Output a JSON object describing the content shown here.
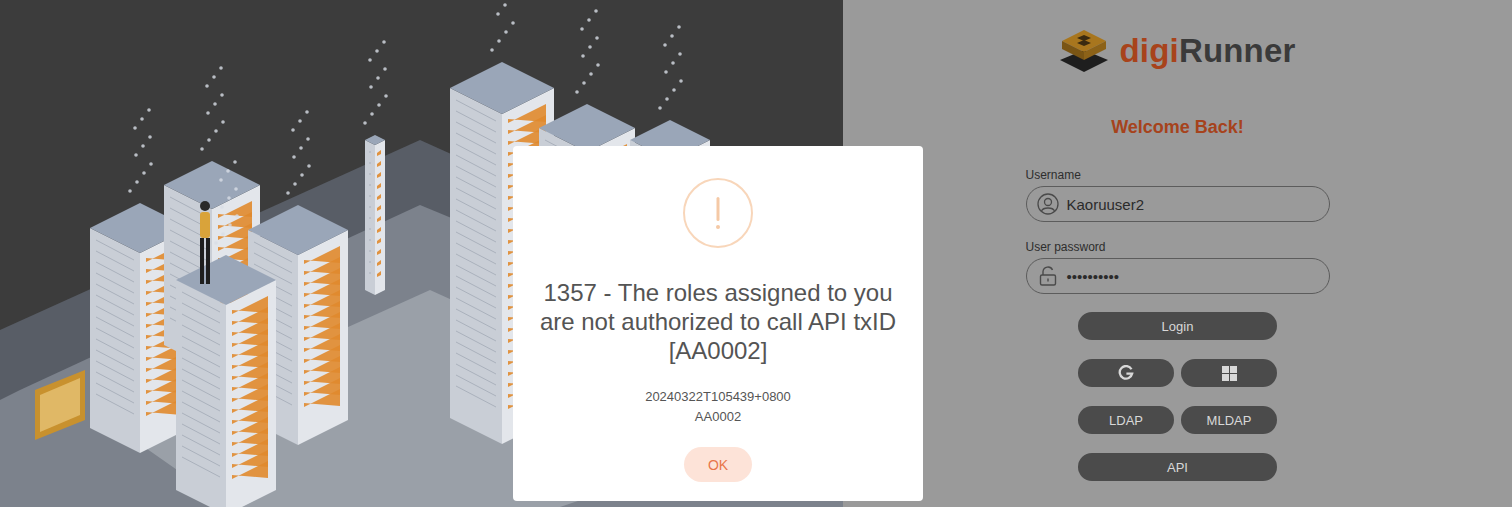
{
  "logo": {
    "part1": "digi",
    "part2": "Runner"
  },
  "heading": "Welcome Back!",
  "form": {
    "username": {
      "label": "Username",
      "value": "Kaoruuser2"
    },
    "password": {
      "label": "User password",
      "value": "••••••••••"
    }
  },
  "button_rows": [
    [
      {
        "kind": "text",
        "label": "Login"
      }
    ],
    [
      {
        "kind": "google"
      },
      {
        "kind": "windows"
      }
    ],
    [
      {
        "kind": "text",
        "label": "LDAP"
      },
      {
        "kind": "text",
        "label": "MLDAP"
      }
    ],
    [
      {
        "kind": "text",
        "label": "API"
      }
    ]
  ],
  "dialog": {
    "title": "1357 - The roles assigned to you are not authorized to call API txID [AA0002]",
    "timestamp": "20240322T105439+0800",
    "code": "AA0002",
    "button": "OK"
  }
}
